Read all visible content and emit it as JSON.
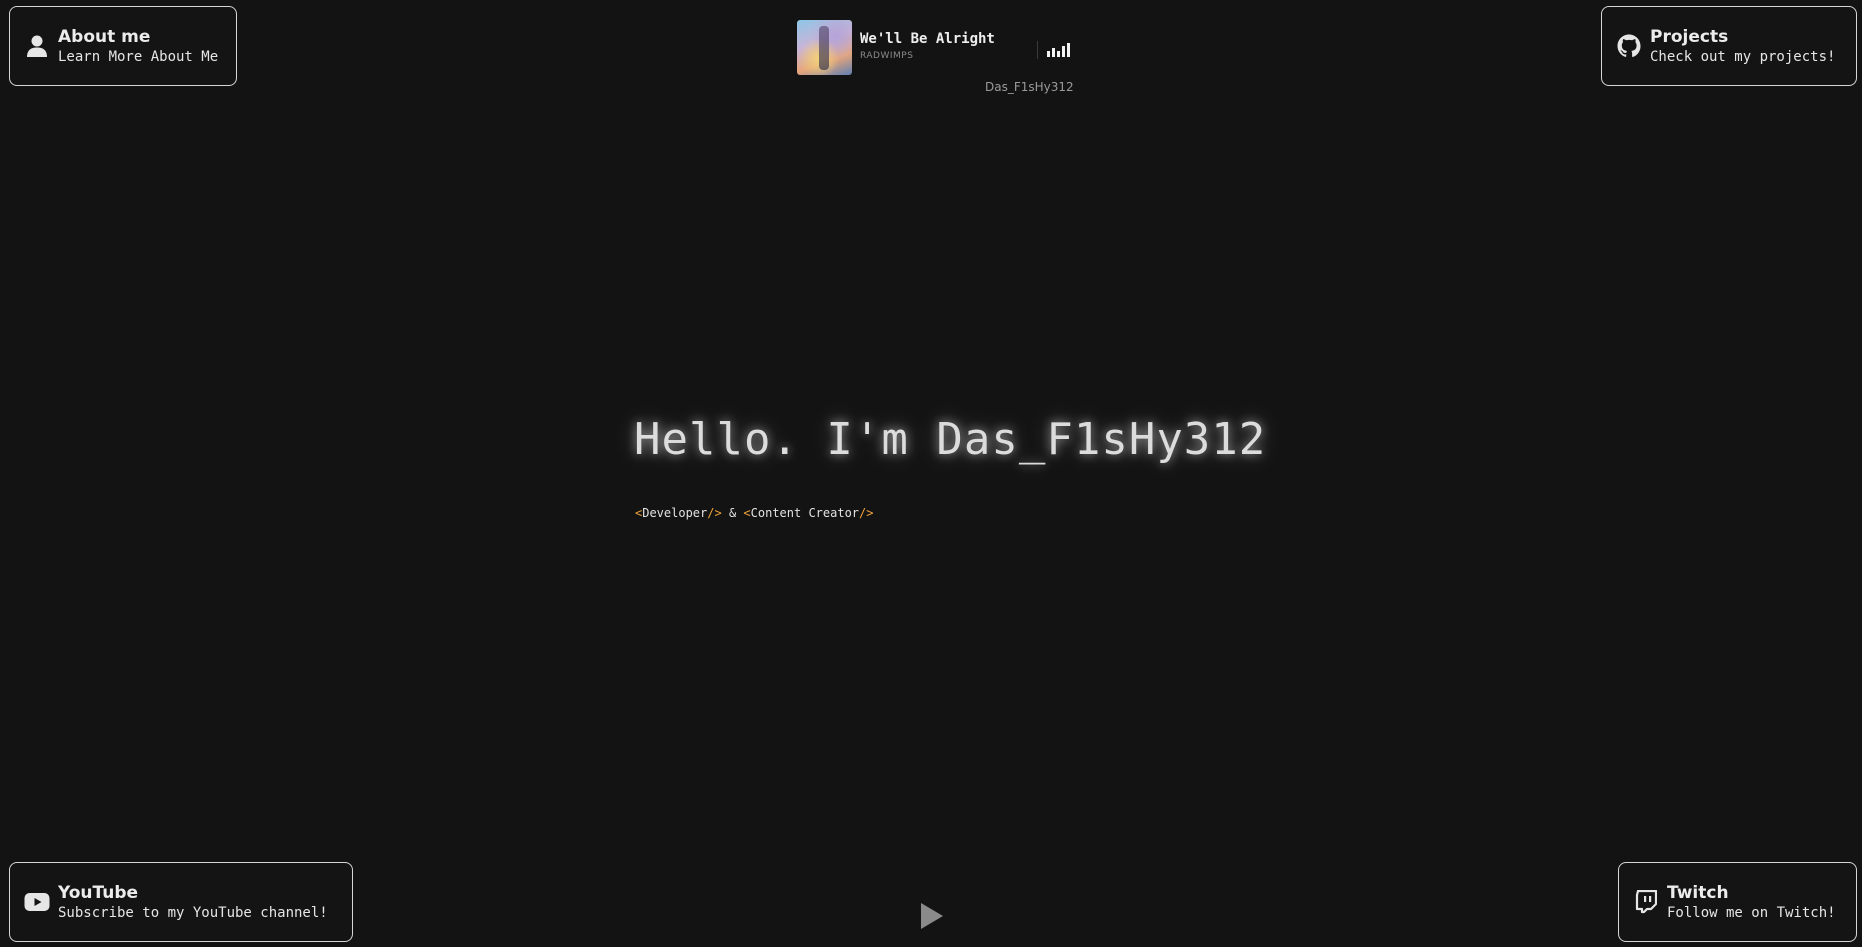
{
  "nav_cards": {
    "about": {
      "title": "About me",
      "subtitle": "Learn More About Me",
      "icon": "user-icon"
    },
    "projects": {
      "title": "Projects",
      "subtitle": "Check out my projects!",
      "icon": "github-icon"
    },
    "youtube": {
      "title": "YouTube",
      "subtitle": "Subscribe to my YouTube channel!",
      "icon": "youtube-icon"
    },
    "twitch": {
      "title": "Twitch",
      "subtitle": "Follow me on Twitch!",
      "icon": "twitch-icon"
    }
  },
  "now_playing": {
    "song": "We'll Be Alright",
    "artist": "RADWIMPS",
    "username": "Das_F1sHy312",
    "status_icon": "equalizer-icon"
  },
  "hero": {
    "greeting": "Hello. I'm Das_F1sHy312",
    "subtitle": {
      "role1": "Developer",
      "separator": "&",
      "role2": "Content Creator"
    }
  },
  "play_button": {
    "icon": "play-icon"
  },
  "colors": {
    "background": "#131313",
    "accent": "#f0a33a",
    "border": "#d6d6d6"
  }
}
